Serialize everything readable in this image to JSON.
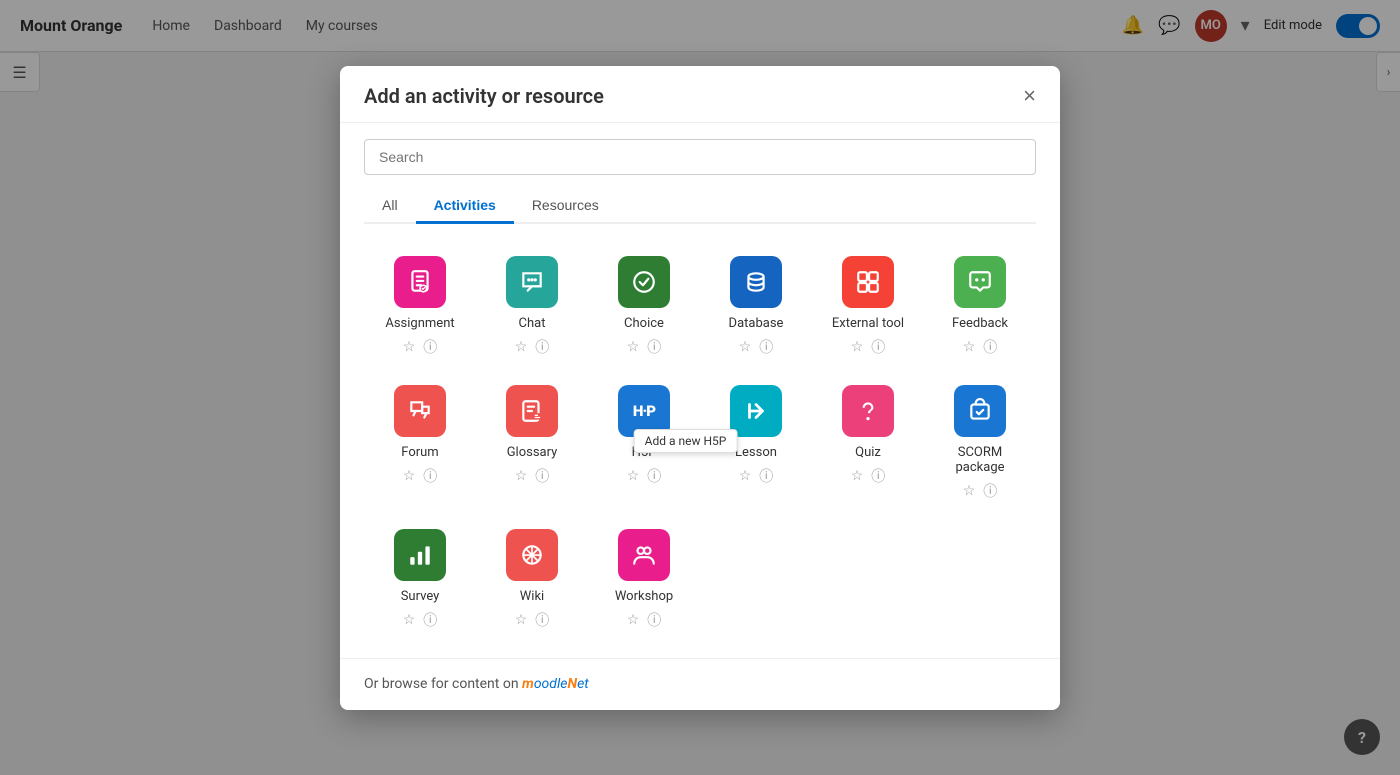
{
  "brand": "Mount Orange",
  "nav": {
    "items": [
      "Home",
      "Dashboard",
      "My courses"
    ]
  },
  "topbar": {
    "edit_mode_label": "Edit mode"
  },
  "modal": {
    "title": "Add an activity or resource",
    "close_label": "×",
    "search_placeholder": "Search",
    "tabs": [
      {
        "id": "all",
        "label": "All"
      },
      {
        "id": "activities",
        "label": "Activities",
        "active": true
      },
      {
        "id": "resources",
        "label": "Resources"
      }
    ],
    "activities": [
      {
        "id": "assignment",
        "name": "Assignment",
        "icon_color": "icon-pink",
        "icon": "📋"
      },
      {
        "id": "chat",
        "name": "Chat",
        "icon_color": "icon-teal",
        "icon": "💬"
      },
      {
        "id": "choice",
        "name": "Choice",
        "icon_color": "icon-green-dark",
        "icon": "✓"
      },
      {
        "id": "database",
        "name": "Database",
        "icon_color": "icon-blue-dark",
        "icon": "🗄"
      },
      {
        "id": "external-tool",
        "name": "External tool",
        "icon_color": "icon-orange-red",
        "icon": "🧩"
      },
      {
        "id": "feedback",
        "name": "Feedback",
        "icon_color": "icon-green",
        "icon": "📣"
      },
      {
        "id": "forum",
        "name": "Forum",
        "icon_color": "icon-coral",
        "icon": "💬"
      },
      {
        "id": "glossary",
        "name": "Glossary",
        "icon_color": "icon-coral",
        "icon": "📖"
      },
      {
        "id": "h5p",
        "name": "H5P",
        "icon_color": "icon-blue",
        "icon": "H·P",
        "has_tooltip": true,
        "tooltip": "Add a new H5P"
      },
      {
        "id": "lesson",
        "name": "Lesson",
        "icon_color": "icon-cyan",
        "icon": "⇄"
      },
      {
        "id": "quiz",
        "name": "Quiz",
        "icon_color": "icon-pink-light",
        "icon": "?"
      },
      {
        "id": "scorm",
        "name": "SCORM package",
        "icon_color": "icon-blue",
        "icon": "📦"
      },
      {
        "id": "survey",
        "name": "Survey",
        "icon_color": "icon-green-dark",
        "icon": "📊"
      },
      {
        "id": "wiki",
        "name": "Wiki",
        "icon_color": "icon-coral",
        "icon": "✱"
      },
      {
        "id": "workshop",
        "name": "Workshop",
        "icon_color": "icon-magenta",
        "icon": "👥"
      }
    ],
    "footer_text": "Or browse for content on ",
    "moodlenet_label": "MoodleNet"
  },
  "help_label": "?"
}
